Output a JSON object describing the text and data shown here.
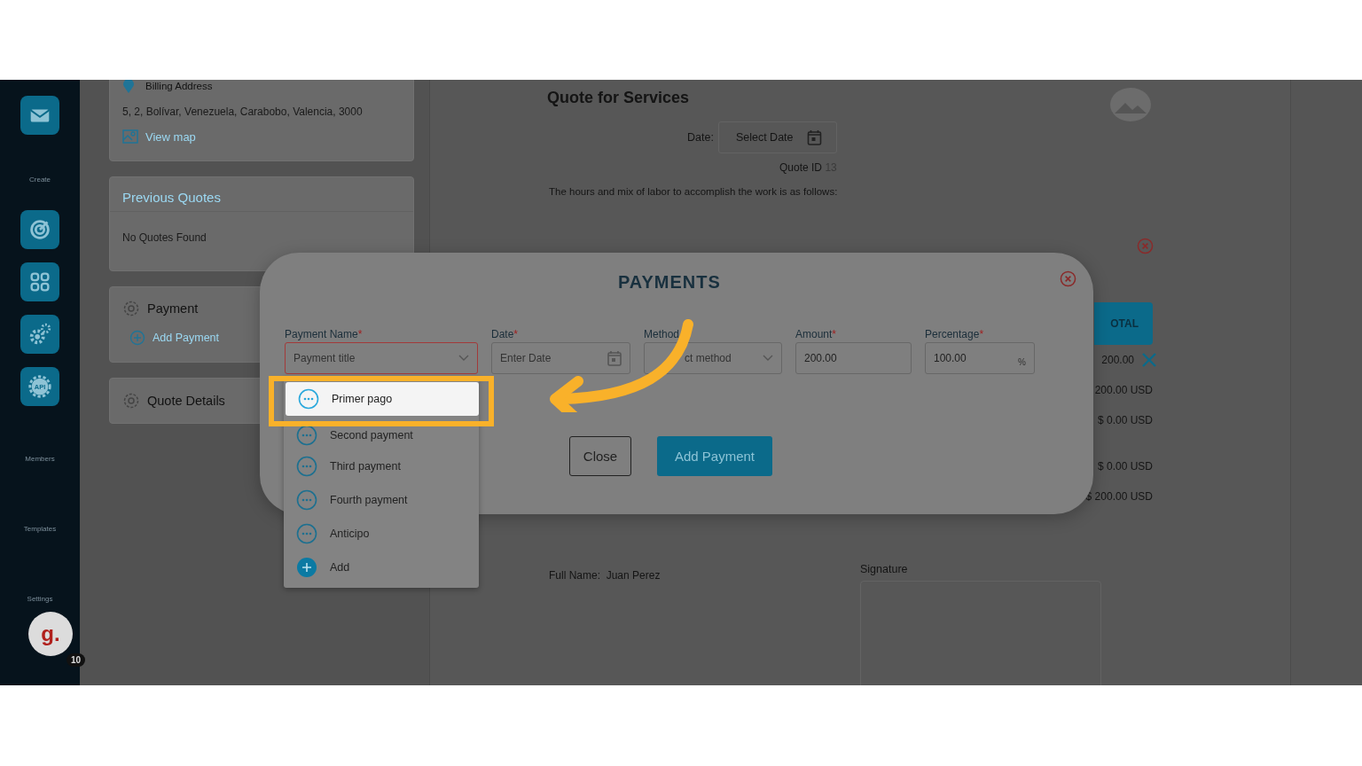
{
  "sidebar": {
    "sections": [
      {
        "label": "Create"
      },
      {
        "label": "Members"
      },
      {
        "label": "Templates"
      },
      {
        "label": "Settings"
      }
    ],
    "api_label": "API",
    "avatar": {
      "initial": "g.",
      "badge": "10"
    }
  },
  "left_panel": {
    "billing": {
      "label": "Billing Address",
      "address": "5, 2, Bolívar, Venezuela, Carabobo, Valencia, 3000",
      "link": "View map"
    },
    "previous_quotes": {
      "title": "Previous Quotes",
      "empty": "No Quotes Found"
    },
    "payment": {
      "title": "Payment",
      "action": "Add Payment"
    },
    "quote_details": {
      "title": "Quote Details"
    }
  },
  "quote": {
    "title": "Quote for Services",
    "date_label": "Date:",
    "date_placeholder": "Select Date",
    "quote_id_label": "Quote ID",
    "quote_id": "13",
    "intro": "The hours and mix of labor to accomplish the work is as follows:",
    "totals": {
      "header": "OTAL",
      "rows": [
        {
          "text": "200.00",
          "removable": true
        },
        {
          "text": "200.00 USD",
          "removable": false
        },
        {
          "text": "$ 0.00 USD",
          "removable": false
        },
        {
          "text": "$ 0.00 USD",
          "removable": false
        },
        {
          "text": "$ 200.00 USD",
          "removable": false
        }
      ]
    },
    "full_name_label": "Full Name:",
    "full_name": "Juan Perez",
    "signature_label": "Signature"
  },
  "modal": {
    "title": "PAYMENTS",
    "fields": [
      {
        "label": "Payment Name",
        "mark": "*",
        "kind": "select",
        "placeholder": "Payment title",
        "invalid": true
      },
      {
        "label": "Date",
        "mark": "*",
        "kind": "date",
        "placeholder": "Enter Date",
        "invalid": false
      },
      {
        "label": "Method",
        "kind": "select",
        "placeholder": "ct method",
        "invalid": false
      },
      {
        "label": "Amount",
        "mark": "*",
        "kind": "text",
        "value": "200.00",
        "invalid": false
      },
      {
        "label": "Percentage",
        "mark": "*",
        "kind": "percent",
        "value": "100.00",
        "suffix": "%",
        "invalid": false
      }
    ],
    "buttons": [
      {
        "label": "Close",
        "kind": "secondary"
      },
      {
        "label": "Add Payment",
        "kind": "primary"
      }
    ],
    "dropdown": [
      {
        "label": "Primer pago",
        "kind": "option",
        "selected": true
      },
      {
        "label": "Second payment",
        "kind": "option",
        "selected": false
      },
      {
        "label": "Third payment",
        "kind": "option",
        "selected": false
      },
      {
        "label": "Fourth payment",
        "kind": "option",
        "selected": false
      },
      {
        "label": "Anticipo",
        "kind": "option",
        "selected": false
      },
      {
        "label": "Add",
        "kind": "add",
        "selected": false
      }
    ]
  }
}
